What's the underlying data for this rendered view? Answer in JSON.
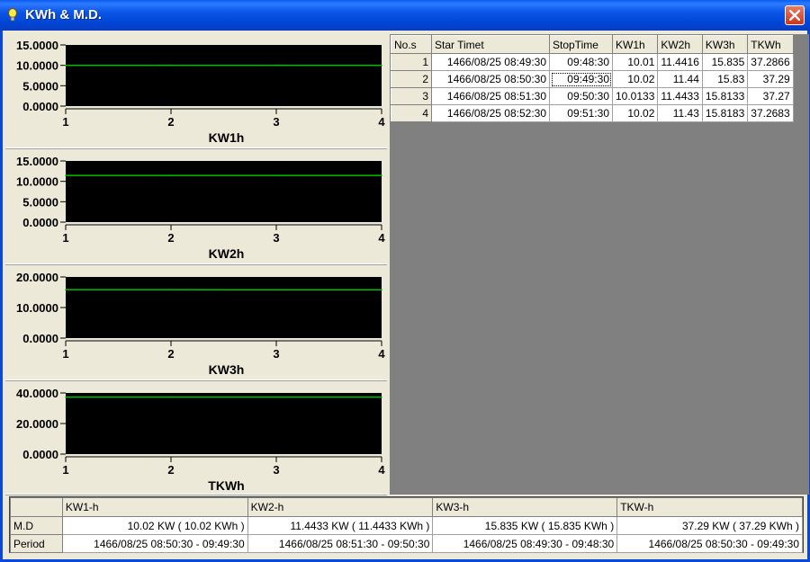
{
  "window": {
    "title": "KWh & M.D."
  },
  "chart_data": [
    {
      "type": "line",
      "x": [
        1,
        2,
        3,
        4
      ],
      "xlabel": "KW1h",
      "ylim": [
        0,
        15
      ],
      "yticks": [
        "15.0000",
        "10.0000",
        "5.0000",
        "0.0000"
      ],
      "ytick_values": [
        15,
        10,
        5,
        0
      ],
      "series": [
        {
          "values": [
            10.01,
            10.02,
            10.0133,
            10.02
          ],
          "color": "#00C000"
        }
      ],
      "background": "#000000"
    },
    {
      "type": "line",
      "x": [
        1,
        2,
        3,
        4
      ],
      "xlabel": "KW2h",
      "ylim": [
        0,
        15
      ],
      "yticks": [
        "15.0000",
        "10.0000",
        "5.0000",
        "0.0000"
      ],
      "ytick_values": [
        15,
        10,
        5,
        0
      ],
      "series": [
        {
          "values": [
            11.4416,
            11.44,
            11.4433,
            11.43
          ],
          "color": "#00C000"
        }
      ],
      "background": "#000000"
    },
    {
      "type": "line",
      "x": [
        1,
        2,
        3,
        4
      ],
      "xlabel": "KW3h",
      "ylim": [
        0,
        20
      ],
      "yticks": [
        "20.0000",
        "10.0000",
        "0.0000"
      ],
      "ytick_values": [
        20,
        10,
        0
      ],
      "series": [
        {
          "values": [
            15.835,
            15.83,
            15.8133,
            15.8183
          ],
          "color": "#00C000"
        }
      ],
      "background": "#000000"
    },
    {
      "type": "line",
      "x": [
        1,
        2,
        3,
        4
      ],
      "xlabel": "TKWh",
      "ylim": [
        0,
        40
      ],
      "yticks": [
        "40.0000",
        "20.0000",
        "0.0000"
      ],
      "ytick_values": [
        40,
        20,
        0
      ],
      "series": [
        {
          "values": [
            37.2866,
            37.29,
            37.27,
            37.2683
          ],
          "color": "#00C000"
        }
      ],
      "background": "#000000"
    }
  ],
  "grid": {
    "headers": [
      "No.s",
      "Star Timet",
      "StopTime",
      "KW1h",
      "KW2h",
      "KW3h",
      "TKWh"
    ],
    "rows": [
      [
        "1",
        "1466/08/25 08:49:30",
        "09:48:30",
        "10.01",
        "11.4416",
        "15.835",
        "37.2866"
      ],
      [
        "2",
        "1466/08/25 08:50:30",
        "09:49:30",
        "10.02",
        "11.44",
        "15.83",
        "37.29"
      ],
      [
        "3",
        "1466/08/25 08:51:30",
        "09:50:30",
        "10.0133",
        "11.4433",
        "15.8133",
        "37.27"
      ],
      [
        "4",
        "1466/08/25 08:52:30",
        "09:51:30",
        "10.02",
        "11.43",
        "15.8183",
        "37.2683"
      ]
    ]
  },
  "summary": {
    "headers": [
      "",
      "KW1-h",
      "KW2-h",
      "KW3-h",
      "TKW-h"
    ],
    "md_label": "M.D",
    "period_label": "Period",
    "md": [
      "10.02 KW ( 10.02 KWh )",
      "11.4433 KW ( 11.4433 KWh )",
      "15.835 KW ( 15.835 KWh )",
      "37.29 KW ( 37.29 KWh )"
    ],
    "period": [
      "1466/08/25 08:50:30 - 09:49:30",
      "1466/08/25 08:51:30 - 09:50:30",
      "1466/08/25 08:49:30 - 09:48:30",
      "1466/08/25 08:50:30 - 09:49:30"
    ]
  },
  "colors": {
    "titlebar": "#0054E3",
    "plot_bg": "#000000",
    "series": "#00C000",
    "grid_bg": "#808080"
  },
  "icons": {
    "window_icon": "lightbulb-icon",
    "close": "close-icon"
  }
}
